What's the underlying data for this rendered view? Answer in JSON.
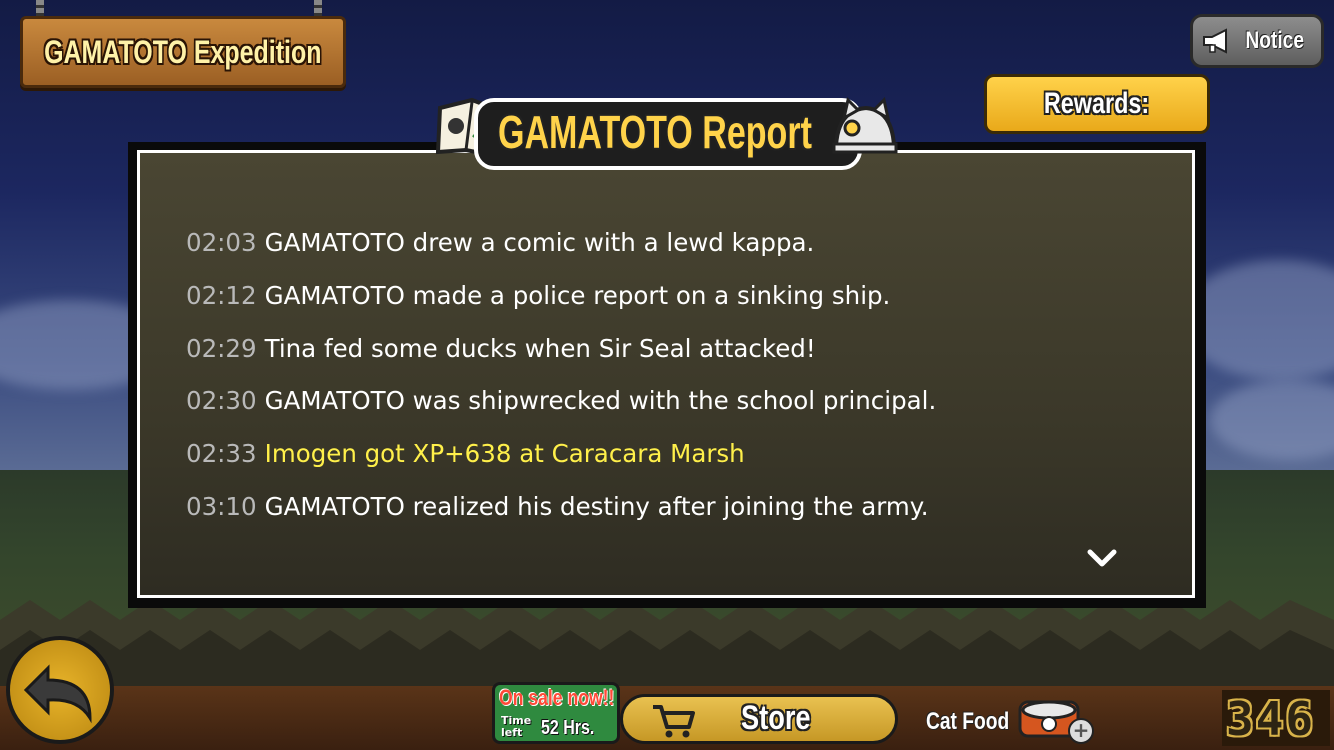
{
  "header": {
    "sign_title": "GAMATOTO Expedition",
    "notice_label": "Notice",
    "rewards_label": "Rewards:"
  },
  "report": {
    "title": "GAMATOTO Report",
    "entries": [
      {
        "time": "02:03",
        "text": "GAMATOTO drew a comic with a lewd kappa.",
        "highlight": false
      },
      {
        "time": "02:12",
        "text": "GAMATOTO made a police report on a sinking ship.",
        "highlight": false
      },
      {
        "time": "02:29",
        "text": "Tina fed some ducks when Sir Seal attacked!",
        "highlight": false
      },
      {
        "time": "02:30",
        "text": "GAMATOTO was shipwrecked with the school principal.",
        "highlight": false
      },
      {
        "time": "02:33",
        "text": "Imogen got XP+638 at Caracara Marsh",
        "highlight": true
      },
      {
        "time": "03:10",
        "text": "GAMATOTO realized his destiny after joining the army.",
        "highlight": false
      }
    ],
    "scroll_icon": "chevron-down-icon"
  },
  "footer": {
    "back_icon": "back-arrow-icon",
    "sale_label": "On sale now!!",
    "sale_time_label": "Time left",
    "sale_hours": "52 Hrs.",
    "store_label": "Store",
    "store_icon": "cart-icon",
    "catfood_label": "Cat Food",
    "catfood_count": "346"
  },
  "colors": {
    "highlight_text": "#fff04a",
    "time_text": "#b9b9b9",
    "title_yellow": "#ffd34a",
    "rewards_yellow": "#f2bb2e"
  }
}
